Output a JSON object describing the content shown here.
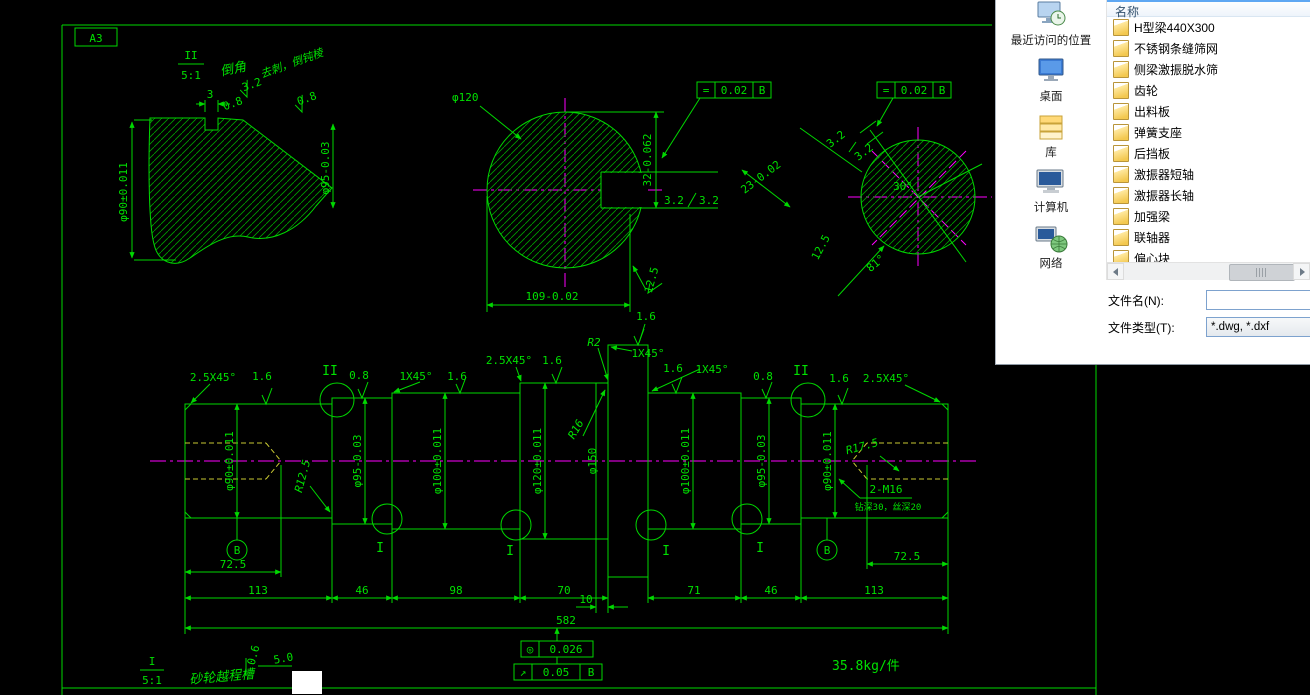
{
  "cad": {
    "sheet_label": "A3",
    "detail_chamfer": {
      "label": "II",
      "scale": "5:1",
      "title": "倒角",
      "rough_top": "3.2",
      "note": "去刺，倒钝棱",
      "rough_right": "0.8",
      "dim_groove_w": "3",
      "dim_groove_d": "0.8",
      "dim_left": "φ90±0.011",
      "dim_right": "φ95-0.03"
    },
    "hub_view": {
      "dia_label": "φ120",
      "key_rough_a": "3.2",
      "key_rough_b": "3.2",
      "key_depth": "32-0.062",
      "across_dim": "109-0.02",
      "rough": "12.5",
      "tol_frame": {
        "symbol": "=",
        "value": "0.02",
        "datum": "B"
      }
    },
    "section_view": {
      "rough_a": "3.2",
      "rough_b": "3.2",
      "angle": "30°",
      "rough_c": "12.5",
      "angle_b": "81°",
      "key_dim": "23-0.02",
      "tol_frame": {
        "symbol": "=",
        "value": "0.02",
        "datum": "B"
      }
    },
    "shaft": {
      "top": [
        "2.5X45°",
        "1.6",
        "II",
        "0.8",
        "1X45°",
        "1.6",
        "2.5X45°",
        "1.6",
        "R2",
        "1X45°",
        "1.6",
        "1.6",
        "1X45°",
        "0.8",
        "II",
        "1.6",
        "2.5X45°"
      ],
      "dias": [
        "φ90±0.011",
        "R12.5",
        "φ95-0.03",
        "φ100±0.011",
        "φ120±0.011",
        "φ150",
        "R16",
        "φ100±0.011",
        "φ95-0.03",
        "φ90±0.011",
        "R17.5",
        "2-M16",
        "钻深30，丝深20"
      ],
      "datum": "B",
      "sections": [
        "I",
        "I",
        "I",
        "I"
      ],
      "dims": [
        "72.5",
        "113",
        "46",
        "98",
        "70",
        "10",
        "71",
        "46",
        "113",
        "72.5",
        "582"
      ],
      "tol_frames": [
        {
          "symbol": "◎",
          "value": "0.026",
          "datum": ""
        },
        {
          "symbol": "↗",
          "value": "0.05",
          "datum": "B"
        }
      ],
      "weight": "35.8kg/件"
    },
    "detail_groove": {
      "label": "I",
      "scale": "5:1",
      "title": "砂轮越程槽",
      "dim_a": "0.6",
      "dim_b": "5.0"
    }
  },
  "dialog": {
    "places": [
      {
        "label": "最近访问的位置"
      },
      {
        "label": "桌面"
      },
      {
        "label": "库"
      },
      {
        "label": "计算机"
      },
      {
        "label": "网络"
      }
    ],
    "list": {
      "header": "名称",
      "files": [
        "H型梁440X300",
        "不锈钢条缝筛网",
        "侧梁激振脱水筛",
        "齿轮",
        "出料板",
        "弹簧支座",
        "后挡板",
        "激振器短轴",
        "激振器长轴",
        "加强梁",
        "联轴器",
        "偏心块"
      ]
    },
    "filename_label": "文件名(N):",
    "filename_value": "",
    "filetype_label": "文件类型(T):",
    "filetype_value": "*.dwg, *.dxf"
  }
}
